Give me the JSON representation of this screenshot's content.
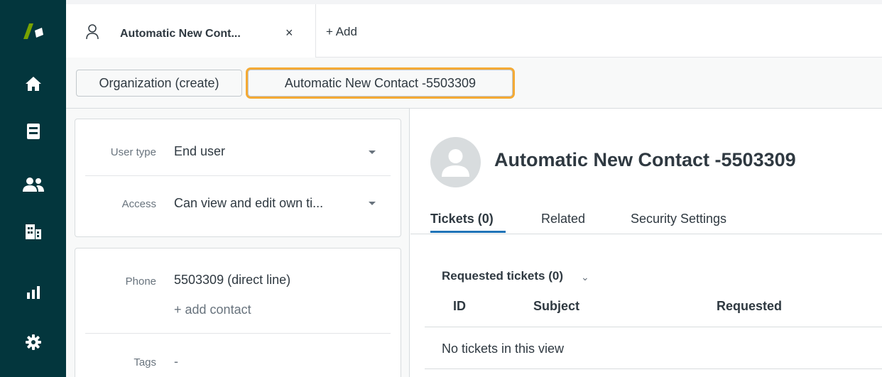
{
  "nav": {
    "items": [
      {
        "name": "logo",
        "icon": "zendesk-logo-icon"
      },
      {
        "name": "home",
        "icon": "home-icon"
      },
      {
        "name": "views",
        "icon": "views-icon"
      },
      {
        "name": "customers",
        "icon": "users-icon"
      },
      {
        "name": "organizations",
        "icon": "building-icon"
      },
      {
        "name": "reporting",
        "icon": "bar-chart-icon"
      },
      {
        "name": "admin",
        "icon": "gear-icon"
      }
    ]
  },
  "tabbar": {
    "active_tab": {
      "title": "Automatic New Cont...",
      "close": "×",
      "icon": "user-icon"
    },
    "add_label": "+ Add"
  },
  "breadcrumb": {
    "organization": "Organization (create)",
    "contact": "Automatic New Contact -5503309"
  },
  "properties": {
    "user_type": {
      "label": "User type",
      "value": "End user"
    },
    "access": {
      "label": "Access",
      "value": "Can view and edit own ti..."
    },
    "phone": {
      "label": "Phone",
      "value": "5503309 (direct line)",
      "add_contact": "+ add contact"
    },
    "tags": {
      "label": "Tags",
      "value": "-"
    }
  },
  "profile": {
    "name": "Automatic New Contact -5503309",
    "tabs": [
      {
        "label": "Tickets (0)",
        "active": true
      },
      {
        "label": "Related",
        "active": false
      },
      {
        "label": "Security Settings",
        "active": false
      }
    ]
  },
  "tickets": {
    "section_title": "Requested tickets (0)",
    "chevron": "⌄",
    "columns": [
      "ID",
      "Subject",
      "Requested"
    ],
    "empty_message": "No tickets in this view"
  },
  "colors": {
    "rail": "#03363d",
    "logo_green": "#78a300",
    "highlight": "#f4aa35",
    "active_tab_underline": "#1f73b7"
  }
}
